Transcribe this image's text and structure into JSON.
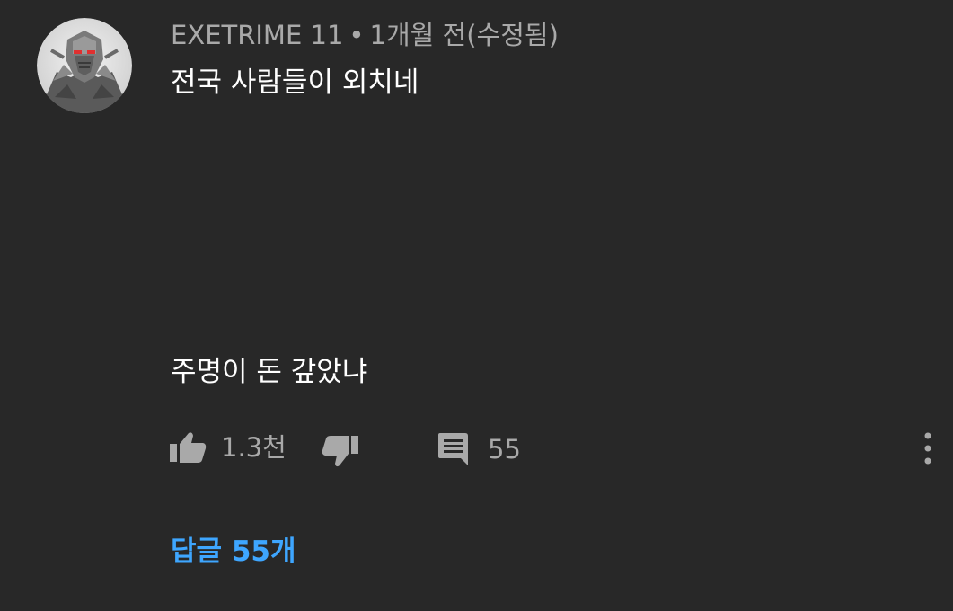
{
  "comment": {
    "author": "EXETRIME 11",
    "separator": "•",
    "timestamp": "1개월 전(수정됨)",
    "lines": [
      "전국 사람들이 외치네",
      "주명이 돈 갚았냐"
    ],
    "avatar_icon": "robot-avatar-icon"
  },
  "actions": {
    "like_icon": "thumb-up-icon",
    "like_count": "1.3천",
    "dislike_icon": "thumb-down-icon",
    "reply_icon": "comment-icon",
    "reply_count": "55",
    "more_icon": "more-vert-icon"
  },
  "replies": {
    "label": "답글 55개"
  },
  "colors": {
    "background": "#282828",
    "text_primary": "#ffffff",
    "text_secondary": "#a9a9a9",
    "link": "#3ea6ff"
  }
}
